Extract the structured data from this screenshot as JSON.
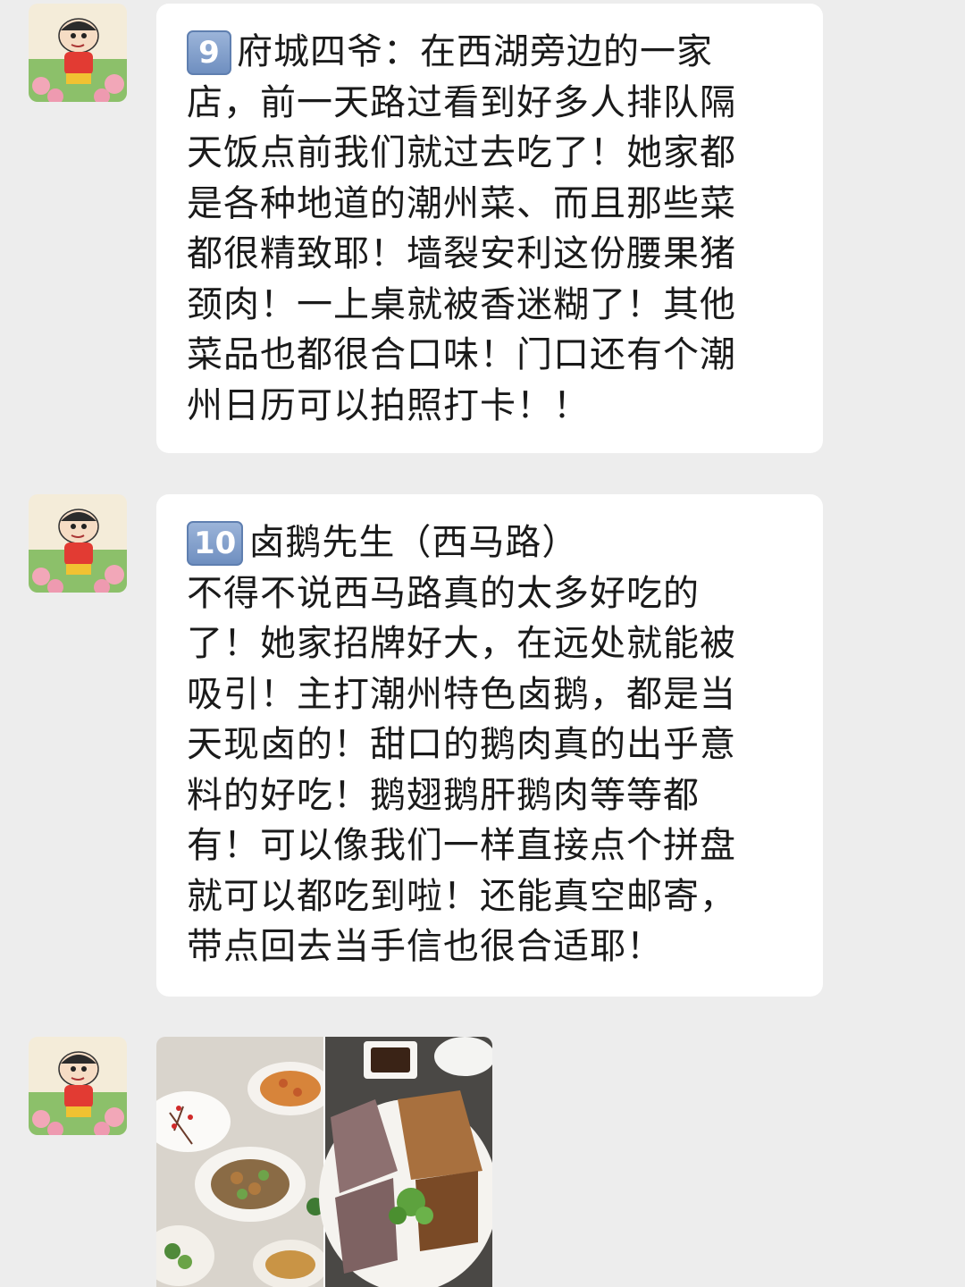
{
  "messages": [
    {
      "badge": "9",
      "lines": [
        "府城四爷：在西湖旁边的一家",
        "店，前一天路过看到好多人排队隔",
        "天饭点前我们就过去吃了！她家都",
        "是各种地道的潮州菜、而且那些菜",
        "都很精致耶！墙裂安利这份腰果猪",
        "颈肉！一上桌就被香迷糊了！其他",
        "菜品也都很合口味！门口还有个潮",
        "州日历可以拍照打卡！！"
      ]
    },
    {
      "badge": "10",
      "lines": [
        "卤鹅先生（西马路）",
        "不得不说西马路真的太多好吃的",
        "了！她家招牌好大，在远处就能被",
        "吸引！主打潮州特色卤鹅，都是当",
        "天现卤的！甜口的鹅肉真的出乎意",
        "料的好吃！鹅翅鹅肝鹅肉等等都",
        "有！可以像我们一样直接点个拼盘",
        "就可以都吃到啦！还能真空邮寄，",
        "带点回去当手信也很合适耶！"
      ]
    }
  ],
  "colors": {
    "background": "#ededed",
    "bubble": "#ffffff",
    "text": "#1a1a1a",
    "badge": "#7f9ccc"
  }
}
